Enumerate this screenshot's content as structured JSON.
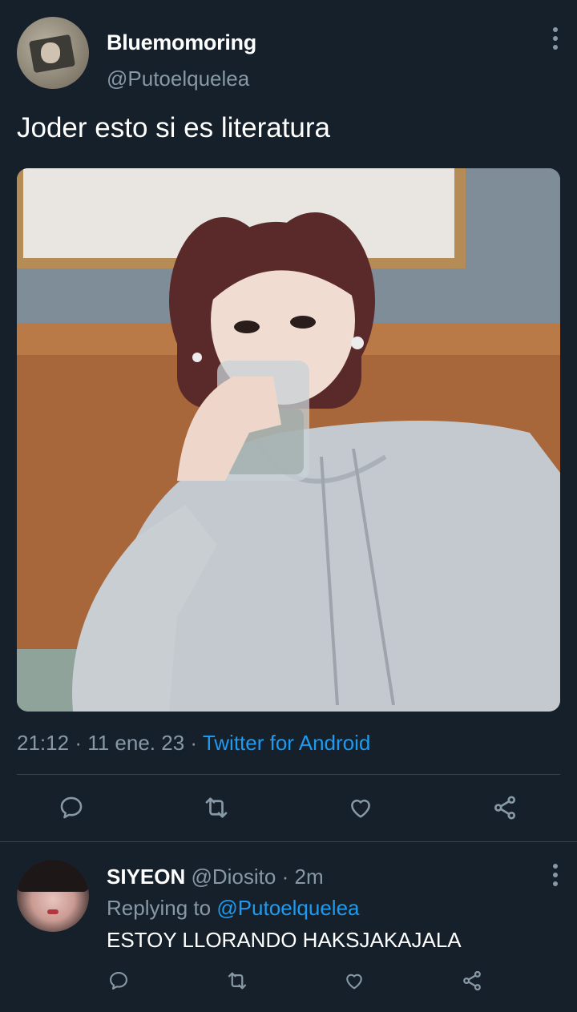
{
  "tweet": {
    "author_name": "Bluemomoring",
    "author_handle": "@Putoelquelea",
    "text": "Joder esto si es literatura",
    "time": "21:12",
    "date": "11 ene. 23",
    "source": "Twitter for Android",
    "actions": [
      {
        "icon": "reply-icon"
      },
      {
        "icon": "retweet-icon"
      },
      {
        "icon": "like-icon"
      },
      {
        "icon": "share-icon"
      }
    ]
  },
  "reply": {
    "author_name": "SIYEON",
    "author_handle": "@Diosito",
    "age": "2m",
    "replying_prefix": "Replying to",
    "replying_handle": "@Putoelquelea",
    "text": "ESTOY LLORANDO HAKSJAKAJALA"
  },
  "colors": {
    "background": "#15202b",
    "secondary_text": "#8899a6",
    "accent": "#1d9bf0",
    "divider": "#38444d"
  }
}
